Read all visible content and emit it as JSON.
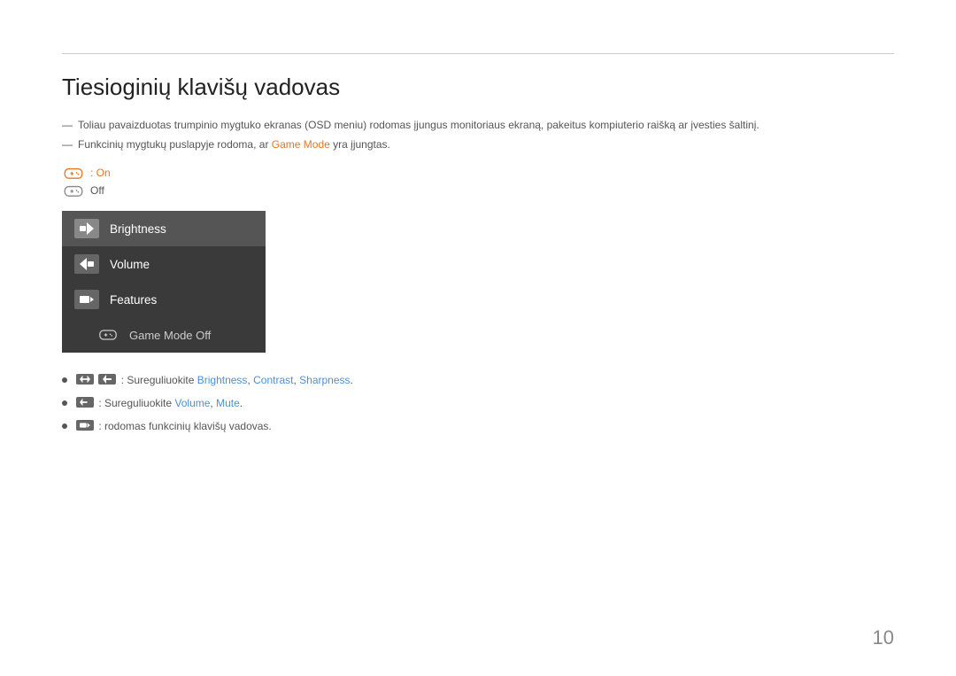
{
  "page": {
    "title": "Tiesioginių klavišų vadovas",
    "number": "10",
    "descriptions": [
      "Toliau pavaizduotas trumpinio mygtuko ekranas (OSD meniu) rodomas įjungus monitoriaus ekraną, pakeitus kompiuterio raišką ar įvesties šaltinį.",
      "Funkcinių mygtukų puslapyje rodoma, ar Game Mode yra įjungtas."
    ],
    "desc_highlight_1": "Game Mode",
    "icon_on_label": ": On",
    "icon_off_label": "Off",
    "osd_menu": {
      "items": [
        {
          "id": "brightness",
          "label": "Brightness",
          "active": true
        },
        {
          "id": "volume",
          "label": "Volume",
          "active": false
        },
        {
          "id": "features",
          "label": "Features",
          "active": false
        }
      ],
      "subitem": {
        "label": "Game Mode Off"
      }
    },
    "bullets": [
      {
        "text_before": ": Sureguliuokite ",
        "links": [
          "Brightness",
          "Contrast",
          "Sharpness"
        ],
        "text_after": "."
      },
      {
        "text_before": ": Sureguliuokite ",
        "links": [
          "Volume",
          "Mute"
        ],
        "text_after": "."
      },
      {
        "text_before": ": rodomas funkcinių klavišų vadovas.",
        "links": [],
        "text_after": ""
      }
    ]
  }
}
